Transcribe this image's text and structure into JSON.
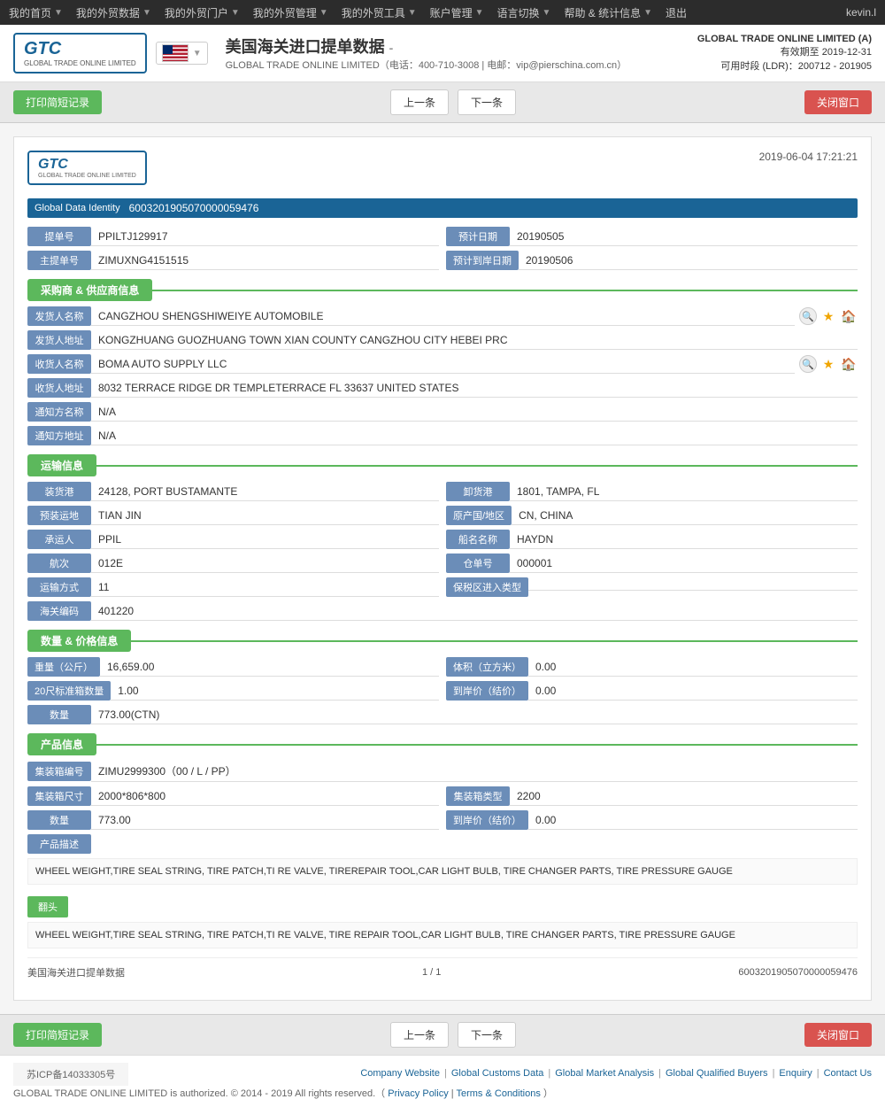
{
  "topNav": {
    "items": [
      {
        "label": "我的首页",
        "hasArrow": true
      },
      {
        "label": "我的外贸数据",
        "hasArrow": true
      },
      {
        "label": "我的外贸门户",
        "hasArrow": true
      },
      {
        "label": "我的外贸管理",
        "hasArrow": true
      },
      {
        "label": "我的外贸工具",
        "hasArrow": true
      },
      {
        "label": "账户管理",
        "hasArrow": true
      },
      {
        "label": "语言切换",
        "hasArrow": true
      },
      {
        "label": "帮助 & 统计信息",
        "hasArrow": true
      },
      {
        "label": "退出"
      }
    ],
    "user": "kevin.l"
  },
  "header": {
    "logoText": "GTC",
    "logoSub": "GLOBAL TRADE ONLINE LIMITED",
    "title": "美国海关进口提单数据",
    "subtitle": "GLOBAL TRADE ONLINE LIMITED（电话：400-710-3008 | 电邮：vip@pierschina.com.cn）",
    "company": "GLOBAL TRADE ONLINE LIMITED (A)",
    "expiry": "有效期至 2019-12-31",
    "ldr": "可用时段 (LDR)：200712 - 201905"
  },
  "toolbar": {
    "printBtn": "打印简短记录",
    "prevBtn": "上一条",
    "nextBtn": "下一条",
    "closeBtn": "关闭窗口"
  },
  "document": {
    "datetime": "2019-06-04 17:21:21",
    "gdi": {
      "label": "Global Data Identity",
      "value": "6003201905070000059476"
    },
    "billNo": {
      "label": "提单号",
      "value": "PPILTJ129917"
    },
    "arrivalDate": {
      "label": "预计日期",
      "value": "20190505"
    },
    "mainBillNo": {
      "label": "主提单号",
      "value": "ZIMUXNG4151515"
    },
    "expectedArrival": {
      "label": "预计到岸日期",
      "value": "20190506"
    },
    "sections": {
      "supply": {
        "title": "采购商 & 供应商信息"
      },
      "transport": {
        "title": "运输信息"
      },
      "data": {
        "title": "数量 & 价格信息"
      },
      "product": {
        "title": "产品信息"
      }
    },
    "shipper": {
      "name": {
        "label": "发货人名称",
        "value": "CANGZHOU SHENGSHIWEIYE AUTOMOBILE"
      },
      "address": {
        "label": "发货人地址",
        "value": "KONGZHUANG GUOZHUANG TOWN XIAN COUNTY CANGZHOU CITY HEBEI PRC"
      }
    },
    "consignee": {
      "name": {
        "label": "收货人名称",
        "value": "BOMA AUTO SUPPLY LLC"
      },
      "address": {
        "label": "收货人地址",
        "value": "8032 TERRACE RIDGE DR TEMPLETERRACE FL 33637 UNITED STATES"
      }
    },
    "notify": {
      "name": {
        "label": "通知方名称",
        "value": "N/A"
      },
      "address": {
        "label": "通知方地址",
        "value": "N/A"
      }
    },
    "transport": {
      "loadPort": {
        "label": "装货港",
        "value": "24128, PORT BUSTAMANTE"
      },
      "unloadPort": {
        "label": "卸货港",
        "value": "1801, TAMPA, FL"
      },
      "preLoading": {
        "label": "预装运地",
        "value": "TIAN JIN"
      },
      "origin": {
        "label": "原产国/地区",
        "value": "CN, CHINA"
      },
      "carrier": {
        "label": "承运人",
        "value": "PPIL"
      },
      "vesselName": {
        "label": "船名名称",
        "value": "HAYDN"
      },
      "voyage": {
        "label": "航次",
        "value": "012E"
      },
      "warehouseNo": {
        "label": "仓单号",
        "value": "000001"
      },
      "transport": {
        "label": "运输方式",
        "value": "11"
      },
      "bonded": {
        "label": "保税区进入类型",
        "value": ""
      },
      "customs": {
        "label": "海关编码",
        "value": "401220"
      }
    },
    "quantity": {
      "weight": {
        "label": "重量（公斤）",
        "value": "16,659.00"
      },
      "volume": {
        "label": "体积（立方米）",
        "value": "0.00"
      },
      "container20": {
        "label": "20尺标准箱数量",
        "value": "1.00"
      },
      "arrivalPrice": {
        "label": "到岸价（结价）",
        "value": "0.00"
      },
      "quantity": {
        "label": "数量",
        "value": "773.00(CTN)"
      }
    },
    "product": {
      "containerNo": {
        "label": "集装箱编号",
        "value": "ZIMU2999300（00 / L / PP）"
      },
      "containerSize": {
        "label": "集装箱尺寸",
        "value": "2000*806*800"
      },
      "containerType": {
        "label": "集装箱类型",
        "value": "2200"
      },
      "quantity": {
        "label": "数量",
        "value": "773.00"
      },
      "arrivalPrice": {
        "label": "到岸价（结价）",
        "value": "0.00"
      },
      "descLabel": "产品描述",
      "desc": "WHEEL WEIGHT,TIRE SEAL STRING, TIRE PATCH,TI RE VALVE, TIREREPAIR TOOL,CAR LIGHT BULB, TIRE CHANGER PARTS, TIRE PRESSURE GAUGE",
      "translateBtn": "翻头",
      "translated": "WHEEL WEIGHT,TIRE SEAL STRING, TIRE PATCH,TI RE VALVE, TIRE REPAIR TOOL,CAR LIGHT BULB, TIRE CHANGER PARTS, TIRE PRESSURE GAUGE"
    },
    "footer": {
      "left": "美国海关进口提单数据",
      "page": "1 / 1",
      "right": "6003201905070000059476"
    }
  },
  "bottomToolbar": {
    "printBtn": "打印简短记录",
    "prevBtn": "上一条",
    "nextBtn": "下一条",
    "closeBtn": "关闭窗口"
  },
  "pageFooter": {
    "links": [
      "Company Website",
      "Global Customs Data",
      "Global Market Analysis",
      "Global Qualified Buyers",
      "Enquiry",
      "Contact Us"
    ],
    "copyright": "GLOBAL TRADE ONLINE LIMITED is authorized. © 2014 - 2019 All rights reserved.（",
    "privacy": "Privacy Policy",
    "terms": "Terms & Conditions",
    "end": "）",
    "icp": "苏ICP备14033305号"
  }
}
